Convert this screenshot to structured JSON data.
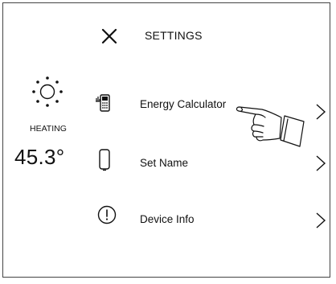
{
  "header": {
    "title": "SETTINGS",
    "close_icon": "close-icon"
  },
  "status": {
    "icon": "sun-icon",
    "mode": "HEATING",
    "temperature": "45.3°"
  },
  "menu": {
    "items": [
      {
        "label": "Energy Calculator",
        "icon": "energy-meter-icon",
        "chevron": "chevron-right-icon"
      },
      {
        "label": "Set Name",
        "icon": "device-icon",
        "chevron": "chevron-right-icon"
      },
      {
        "label": "Device Info",
        "icon": "info-icon",
        "chevron": "chevron-right-icon"
      }
    ]
  },
  "pointer": {
    "icon": "pointing-hand-icon"
  },
  "colors": {
    "text": "#111111",
    "border": "#444444",
    "background": "#ffffff"
  }
}
